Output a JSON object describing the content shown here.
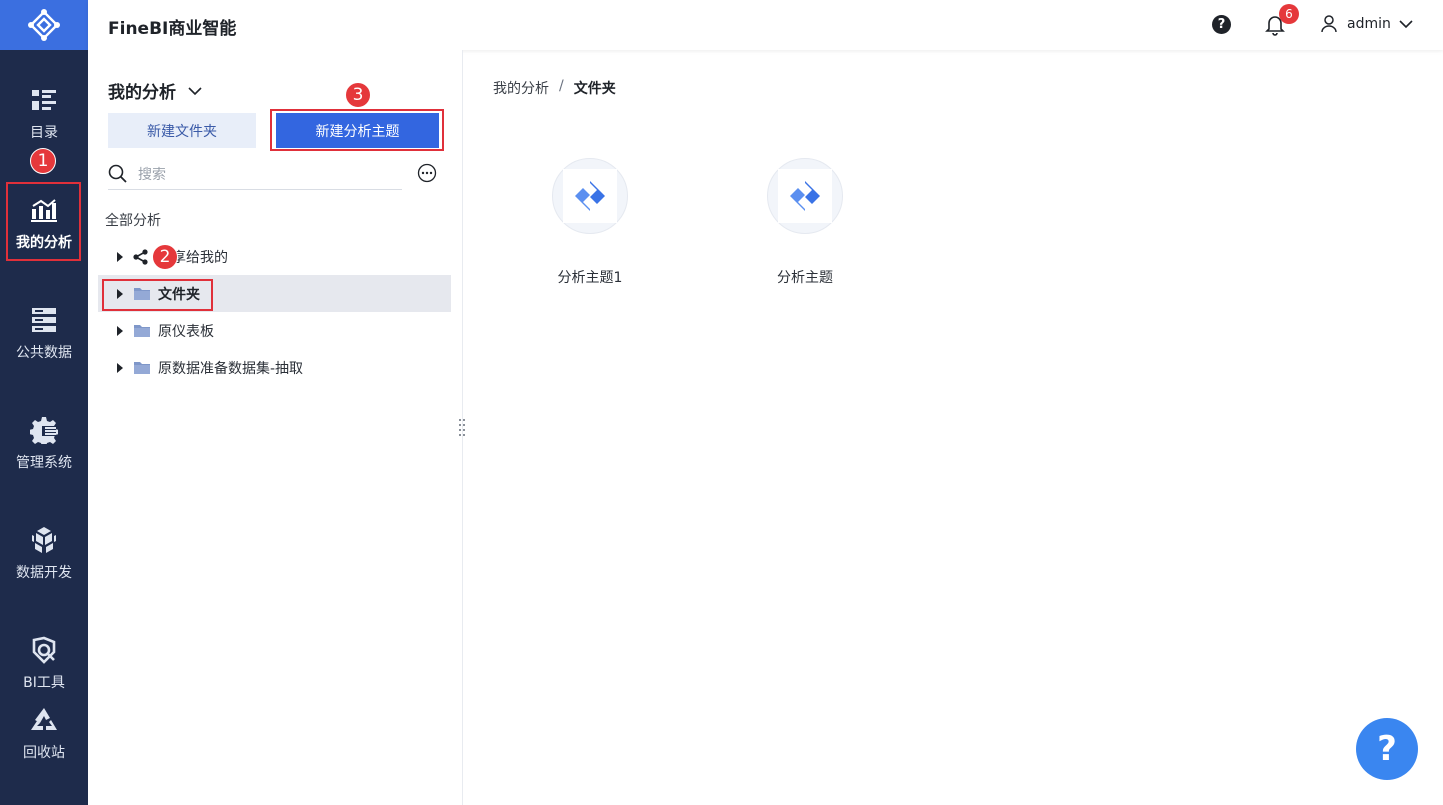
{
  "app": {
    "title": "FineBI商业智能"
  },
  "header": {
    "notification_count": "6",
    "user": "admin",
    "help_glyph": "?"
  },
  "nav": {
    "items": [
      {
        "label": "目录",
        "icon": "catalog-icon"
      },
      {
        "label": "我的分析",
        "icon": "analysis-chart-icon",
        "active": true
      },
      {
        "label": "公共数据",
        "icon": "database-icon"
      },
      {
        "label": "管理系统",
        "icon": "gear-icon"
      },
      {
        "label": "数据开发",
        "icon": "cube-icon"
      },
      {
        "label": "BI工具",
        "icon": "tools-icon"
      },
      {
        "label": "回收站",
        "icon": "recycle-icon"
      }
    ]
  },
  "panel": {
    "title": "我的分析",
    "new_folder_label": "新建文件夹",
    "new_theme_label": "新建分析主题",
    "search_placeholder": "搜索",
    "section_label": "全部分析",
    "tree": [
      {
        "label": "共享给我的",
        "icon": "share-icon"
      },
      {
        "label": "文件夹",
        "icon": "folder-icon",
        "selected": true
      },
      {
        "label": "原仪表板",
        "icon": "folder-icon"
      },
      {
        "label": "原数据准备数据集-抽取",
        "icon": "folder-icon"
      }
    ]
  },
  "steps": {
    "s1": "1",
    "s2": "2",
    "s3": "3"
  },
  "content": {
    "breadcrumb": [
      "我的分析",
      "/",
      "文件夹"
    ],
    "cards": [
      {
        "label": "分析主题1",
        "icon": "analysis-theme-icon"
      },
      {
        "label": "分析主题",
        "icon": "analysis-theme-icon"
      }
    ]
  },
  "fab": {
    "glyph": "?"
  },
  "colors": {
    "nav_bg": "#1e2b4b",
    "brand": "#3b6fe0",
    "primary_button": "#3366e0",
    "highlight_box": "#e0303a",
    "step_badge": "#e5383b",
    "fab": "#3a86f0"
  }
}
